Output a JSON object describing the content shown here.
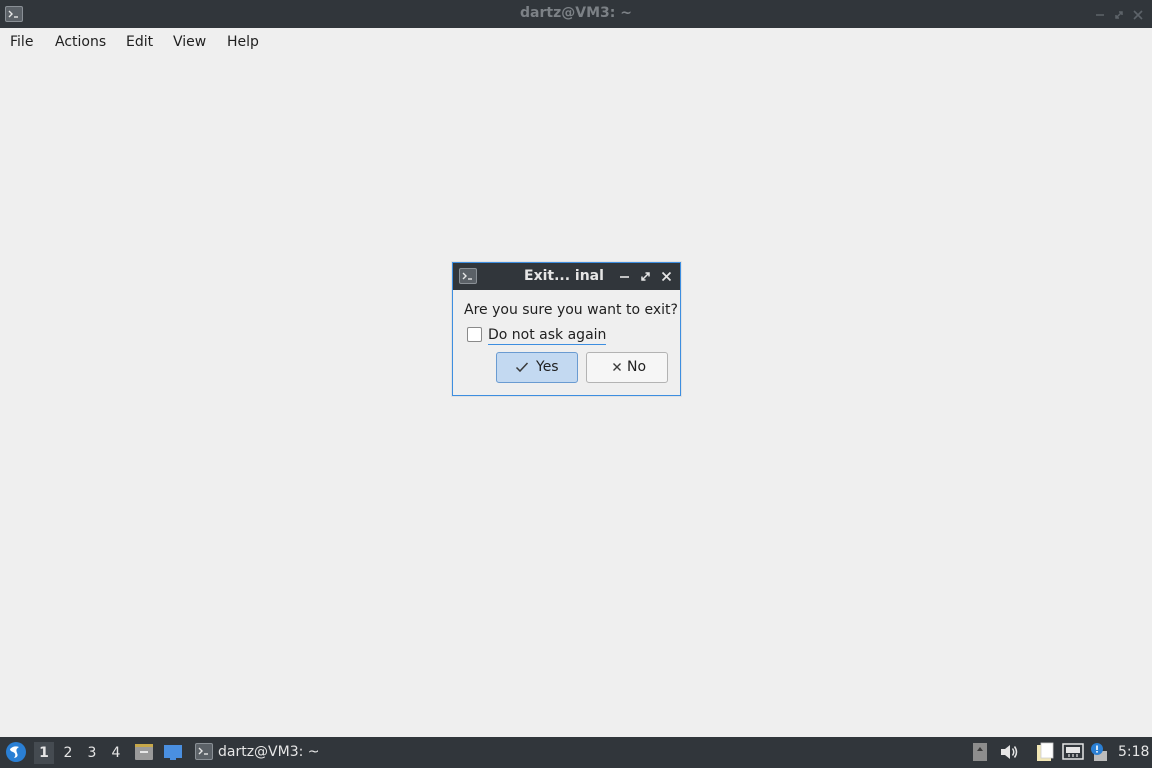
{
  "window": {
    "title": "dartz@VM3: ~",
    "menu": [
      "File",
      "Actions",
      "Edit",
      "View",
      "Help"
    ]
  },
  "dialog": {
    "title": "Exit...  inal",
    "question": "Are you sure you want to exit?",
    "checkbox_label": "Do not ask again",
    "checkbox_checked": false,
    "yes_label": "Yes",
    "no_label": "No"
  },
  "taskbar": {
    "desktops": [
      "1",
      "2",
      "3",
      "4"
    ],
    "active_desktop": "1",
    "task_label": "dartz@VM3: ~",
    "clock": "5:18"
  },
  "icons": {
    "window_icon": "terminal-icon",
    "start": "lxqt-start-icon",
    "quicklaunch": [
      "file-manager-icon",
      "show-desktop-icon"
    ],
    "tray": [
      "storage-icon",
      "volume-icon",
      "clipboard-icon",
      "network-icon",
      "update-notifier-icon"
    ]
  },
  "colors": {
    "titlebar": "#31363b",
    "background": "#efefef",
    "accent": "#3d8ee0",
    "default_button": "#c3d9f1"
  }
}
